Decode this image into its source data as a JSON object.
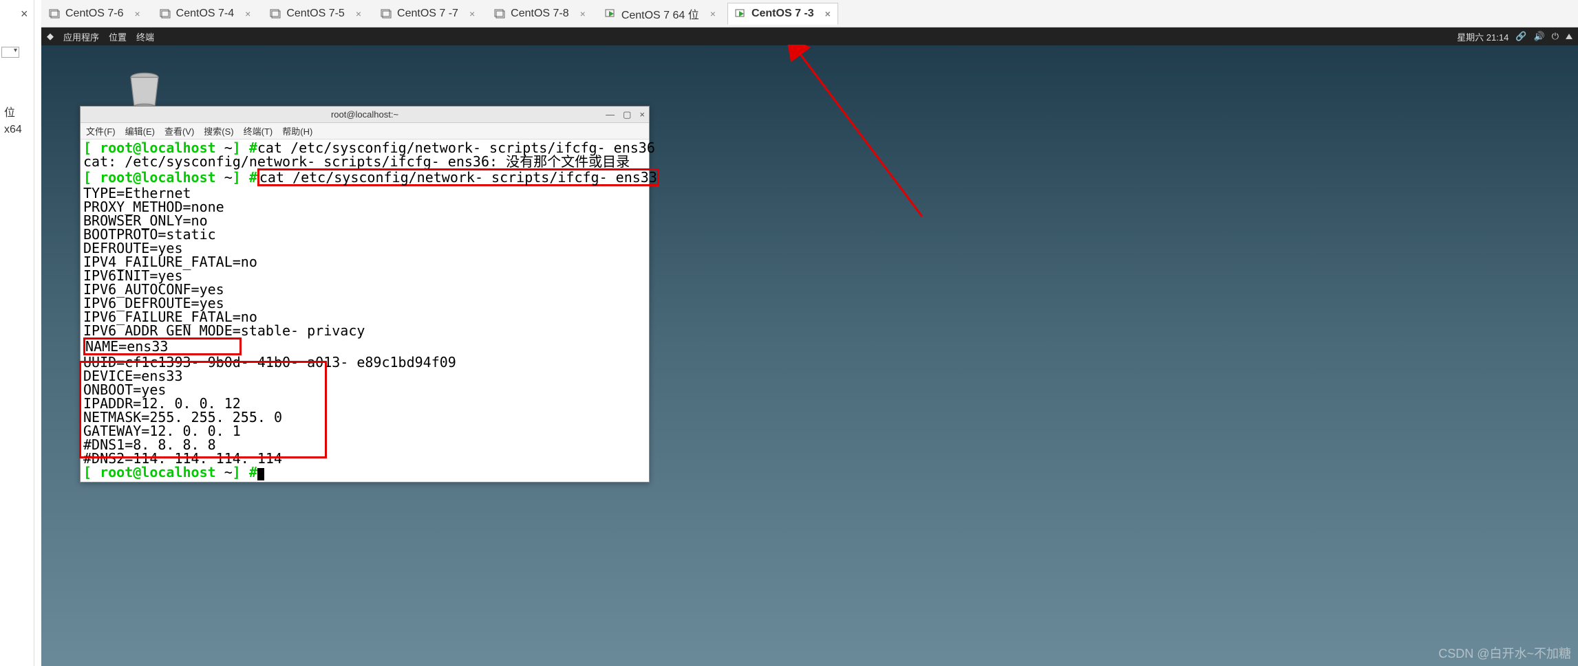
{
  "chrome": {
    "close_glyph": "×",
    "side1": "位",
    "side2": "x64"
  },
  "tabs": [
    {
      "label": "CentOS 7-6",
      "active": false,
      "running": false
    },
    {
      "label": "CentOS 7-4",
      "active": false,
      "running": false
    },
    {
      "label": "CentOS 7-5",
      "active": false,
      "running": false
    },
    {
      "label": "CentOS 7 -7",
      "active": false,
      "running": false
    },
    {
      "label": "CentOS 7-8",
      "active": false,
      "running": false
    },
    {
      "label": "CentOS 7 64 位",
      "active": false,
      "running": true
    },
    {
      "label": "CentOS 7 -3",
      "active": true,
      "running": true
    }
  ],
  "tab_close_glyph": "×",
  "topbar": {
    "apps_icon": "◆",
    "apps": "应用程序",
    "places": "位置",
    "terminal": "终端",
    "datetime": "星期六 21:14",
    "net_icon": "🔗",
    "vol_icon": "🔊",
    "power_icon": "⏻"
  },
  "terminal": {
    "title": "root@localhost:~",
    "min": "—",
    "max": "▢",
    "close": "×",
    "menu": {
      "file": "文件(F)",
      "edit": "编辑(E)",
      "view": "查看(V)",
      "search": "搜索(S)",
      "terminal": "终端(T)",
      "help": "帮助(H)"
    },
    "prompt_open": "[ ",
    "prompt_user": "root@localhost",
    "prompt_path": " ~",
    "prompt_close": "] #",
    "cmd1": "cat /etc/sysconfig/network- scripts/ifcfg- ens36",
    "err1": "cat: /etc/sysconfig/network- scripts/ifcfg- ens36: 没有那个文件或目录",
    "cmd2": "cat /etc/sysconfig/network- scripts/ifcfg- ens33",
    "lines_a": [
      "TYPE=Ethernet",
      "PROXY_METHOD=none",
      "BROWSER_ONLY=no",
      "BOOTPROTO=static",
      "DEFROUTE=yes",
      "IPV4_FAILURE_FATAL=no",
      "IPV6INIT=yes",
      "IPV6_AUTOCONF=yes",
      "IPV6_DEFROUTE=yes",
      "IPV6_FAILURE_FATAL=no",
      "IPV6_ADDR_GEN_MODE=stable- privacy"
    ],
    "name_line": "NAME=ens33",
    "uuid_line": "UUID=cf1c1393- 9b0d- 41b0- a013- e89c1bd94f09",
    "lines_b": [
      "DEVICE=ens33",
      "ONBOOT=yes",
      "IPADDR=12. 0. 0. 12",
      "NETMASK=255. 255. 255. 0",
      "GATEWAY=12. 0. 0. 1",
      "#DNS1=8. 8. 8. 8",
      "#DNS2=114. 114. 114. 114"
    ]
  },
  "watermark": "CSDN @白开水~不加糖"
}
